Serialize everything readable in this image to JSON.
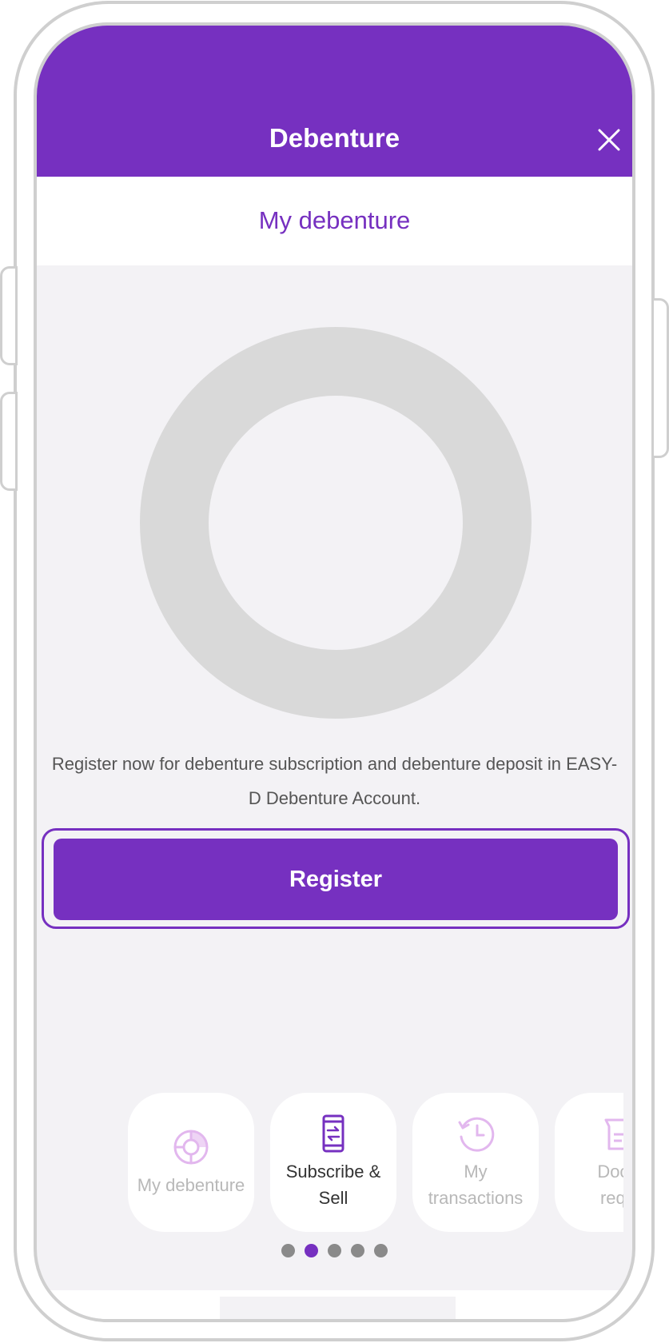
{
  "header": {
    "title": "Debenture"
  },
  "subheader": {
    "title": "My debenture"
  },
  "donut": {
    "ring_color": "#d9d9d9"
  },
  "description": "Register now for debenture subscription and debenture deposit in EASY-D Debenture Account.",
  "register_label": "Register",
  "accent_color": "#7630c0",
  "carousel": {
    "items": [
      {
        "label": "My debenture",
        "icon": "pie-chart-icon",
        "active": false
      },
      {
        "label": "Subscribe &\nSell",
        "icon": "phone-transfer-icon",
        "active": true
      },
      {
        "label": "My\ntransactions",
        "icon": "history-clock-icon",
        "active": false
      },
      {
        "label": "Docu\nrequ",
        "icon": "document-request-icon",
        "active": false
      }
    ],
    "page_count": 5,
    "current_page": 2
  }
}
